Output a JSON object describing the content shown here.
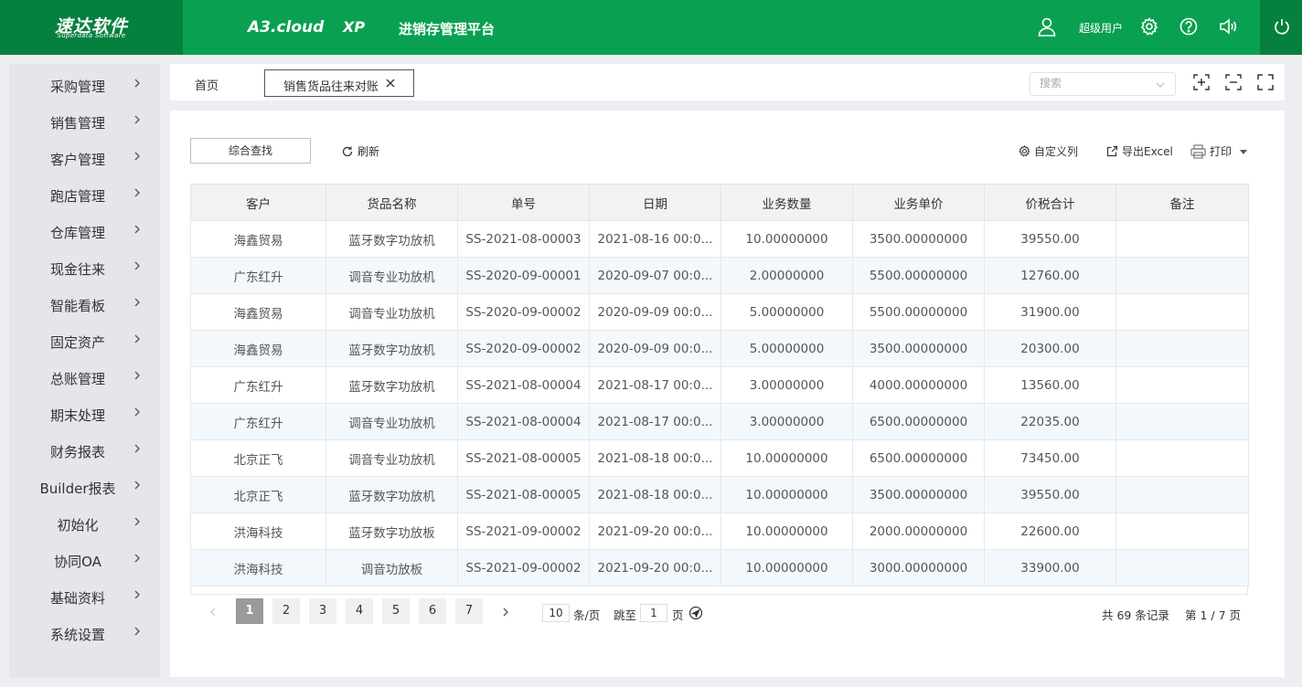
{
  "header": {
    "logo_main": "速达软件",
    "logo_sub": "Superdata Software",
    "nav": [
      "A3.cloud",
      "XP",
      "进销存管理平台"
    ],
    "user_label": "超级用户",
    "icons": [
      "user-icon",
      "gear-icon",
      "help-icon",
      "speaker-icon",
      "power-icon"
    ]
  },
  "sidebar": {
    "items": [
      "采购管理",
      "销售管理",
      "客户管理",
      "跑店管理",
      "仓库管理",
      "现金往来",
      "智能看板",
      "固定资产",
      "总账管理",
      "期末处理",
      "财务报表",
      "Builder报表",
      "初始化",
      "协同OA",
      "基础资料",
      "系统设置"
    ]
  },
  "tabs": {
    "home": "首页",
    "active": "销售货品往来对账",
    "search_placeholder": "搜索"
  },
  "toolbar": {
    "search_button": "综合查找",
    "refresh": "刷新",
    "custom_columns": "自定义列",
    "export": "导出Excel",
    "print": "打印"
  },
  "table": {
    "columns": [
      "客户",
      "货品名称",
      "单号",
      "日期",
      "业务数量",
      "业务单价",
      "价税合计",
      "备注"
    ],
    "rows": [
      [
        "海鑫贸易",
        "蓝牙数字功放机",
        "SS-2021-08-00003",
        "2021-08-16 00:0...",
        "10.00000000",
        "3500.00000000",
        "39550.00",
        ""
      ],
      [
        "广东红升",
        "调音专业功放机",
        "SS-2020-09-00001",
        "2020-09-07 00:0...",
        "2.00000000",
        "5500.00000000",
        "12760.00",
        ""
      ],
      [
        "海鑫贸易",
        "调音专业功放机",
        "SS-2020-09-00002",
        "2020-09-09 00:0...",
        "5.00000000",
        "5500.00000000",
        "31900.00",
        ""
      ],
      [
        "海鑫贸易",
        "蓝牙数字功放机",
        "SS-2020-09-00002",
        "2020-09-09 00:0...",
        "5.00000000",
        "3500.00000000",
        "20300.00",
        ""
      ],
      [
        "广东红升",
        "蓝牙数字功放机",
        "SS-2021-08-00004",
        "2021-08-17 00:0...",
        "3.00000000",
        "4000.00000000",
        "13560.00",
        ""
      ],
      [
        "广东红升",
        "调音专业功放机",
        "SS-2021-08-00004",
        "2021-08-17 00:0...",
        "3.00000000",
        "6500.00000000",
        "22035.00",
        ""
      ],
      [
        "北京正飞",
        "调音专业功放机",
        "SS-2021-08-00005",
        "2021-08-18 00:0...",
        "10.00000000",
        "6500.00000000",
        "73450.00",
        ""
      ],
      [
        "北京正飞",
        "蓝牙数字功放机",
        "SS-2021-08-00005",
        "2021-08-18 00:0...",
        "10.00000000",
        "3500.00000000",
        "39550.00",
        ""
      ],
      [
        "洪海科技",
        "蓝牙数字功放板",
        "SS-2021-09-00002",
        "2021-09-20 00:0...",
        "10.00000000",
        "2000.00000000",
        "22600.00",
        ""
      ],
      [
        "洪海科技",
        "调音功放板",
        "SS-2021-09-00002",
        "2021-09-20 00:0...",
        "10.00000000",
        "3000.00000000",
        "33900.00",
        ""
      ]
    ]
  },
  "pager": {
    "pages": [
      "1",
      "2",
      "3",
      "4",
      "5",
      "6",
      "7"
    ],
    "current": "1",
    "page_size": "10",
    "per_page_label": "条/页",
    "jump_label": "跳至",
    "jump_value": "1",
    "page_suffix": "页",
    "total_text": "共 69 条记录",
    "page_info": "第 1 / 7 页"
  },
  "colors": {
    "header_green": "#0aa052",
    "header_dark_green": "#06803f",
    "sidebar_bg": "#e4e6e9",
    "row_alt": "#f3f8fc",
    "page_active": "#9a9a9a"
  }
}
